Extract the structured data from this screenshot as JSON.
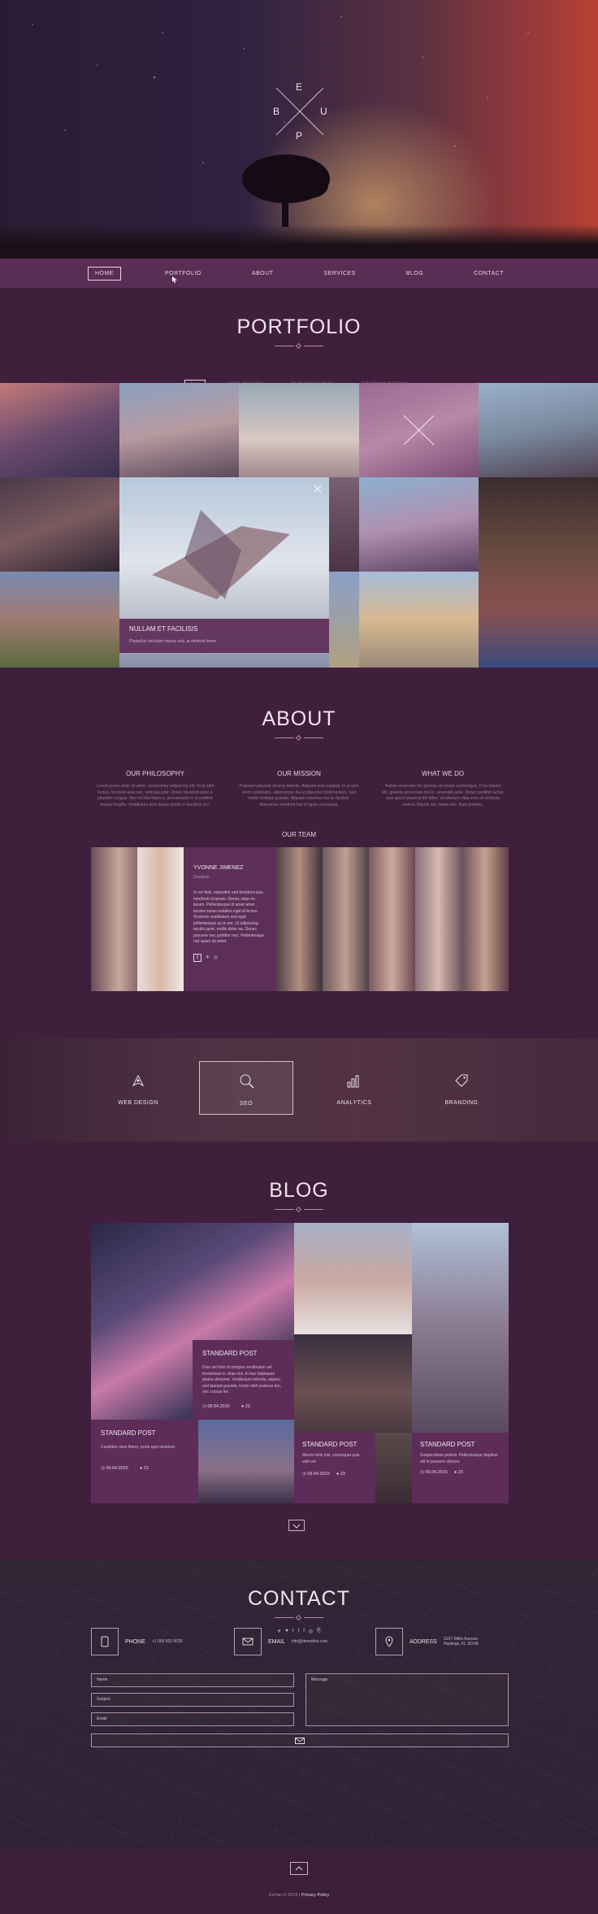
{
  "hero": {
    "logo_letters": [
      "E",
      "B",
      "U",
      "P"
    ]
  },
  "nav": {
    "items": [
      "HOME",
      "PORTFOLIO",
      "ABOUT",
      "SERVICES",
      "BLOG",
      "CONTACT"
    ],
    "active": "HOME"
  },
  "portfolio": {
    "title": "PORTFOLIO",
    "filters": [
      "ALL",
      "WEB DESIGN",
      "PHOTOGRAPHY",
      "GRAPHIC DESIGN"
    ],
    "active_filter": "ALL",
    "featured": {
      "title": "NULLAM ET FACILISIS",
      "subtitle": "Phasellus tincidunt mauris sed, at eleifend lorem"
    }
  },
  "about": {
    "title": "ABOUT",
    "columns": [
      {
        "heading": "OUR PHILOSOPHY",
        "text": "Lorem ipsum dolor sit amet, consectetur adipiscing elit. Ut at nibh luctus, tincidunt ante nec, vehicula ante. Donec tincidunt dolor a pharetra congue. Sed vel feis libero a, penuismodo in ut porttitor massa fringilla. Vestibulum ante ipsum primis in faucibus orci."
      },
      {
        "heading": "OUR MISSION",
        "text": "Praesent placerat sit eros lobortis. Aliquam erat volutpat. In ut sem enim sollicitudin, ullamcorper dui ut placerat condimentum. Sed mattis tristique gravida. Aliquam maximus dui ac facilisis. Maecenas hendrerit fuis in ligula consequat."
      },
      {
        "heading": "WHAT WE DO",
        "text": "Nullam venenatis leo gravida sit ornare scelerisque. Cras mauris elit, gravida accumsan nisi in, venenatis ante. Donec porttitor luctus quis ipsum placerat del lobor. Vestibulum vitae eros sit vehicula viverra. Mauris nec metus feis. Nam pretium."
      }
    ],
    "team_title": "OUR TEAM",
    "member": {
      "name": "YVONNE JIMENEZ",
      "role": "Designer",
      "bio": "In vel felis, imperdiet sed tincidunt quis, hendrerit id ipsum. Donec vitae mi ipsum. Pellentesque id amet amet lacinia varius sodales eget id lectus. Vivamus vestibulum sed eget pellentesque ac in est. Ut adipiscing iaculis jacet, mollis dolor aa. Donec posuere nec porttitor nec. Pellentesque nisl quam sit amet."
    }
  },
  "services": {
    "items": [
      "WEB DESIGN",
      "SEO",
      "ANALYTICS",
      "BRANDING"
    ],
    "active": "SEO"
  },
  "blog": {
    "title": "BLOG",
    "posts": [
      {
        "title": "STANDARD POST",
        "text": "Duis vel felis mi tempus vestibulum vel fermentum in vitae nisi. In hac habitasse platea dictumst. Vestibulum lobortis, sapien sed laoreet gravida, lorem nibh pulvinar leo, nec cursus leo.",
        "date": "09.04.2015",
        "comments": "23"
      },
      {
        "title": "STANDARD POST",
        "text": "Curabitur risus libero, porta quis tincidunt.",
        "date": "09.04.2015",
        "comments": "23"
      },
      {
        "title": "STANDARD POST",
        "text": "Mauris felis nisi, consequat quis velit vel.",
        "date": "09.04.2015",
        "comments": "23"
      },
      {
        "title": "STANDARD POST",
        "text": "Suspendisse potenti. Pellentesque dapibus elit in posuere ultrices.",
        "date": "09.04.2015",
        "comments": "23"
      }
    ]
  },
  "contact": {
    "title": "CONTACT",
    "social": [
      "✈",
      "♥",
      "𝔱",
      "t",
      "f",
      "◎",
      "⎘"
    ],
    "phone": {
      "label": "PHONE",
      "value": "+1 959 603 6035"
    },
    "email": {
      "label": "EMAIL",
      "value": "info@demolink.com"
    },
    "address": {
      "label": "ADDRESS",
      "value": "3167 Willis Avenue Hastings, FL 32145"
    },
    "fields": {
      "name": "Name",
      "subject": "Subject",
      "email": "Email",
      "message": "Message"
    }
  },
  "footer": {
    "copyright": "DeVan © 2015 |",
    "privacy": "Privacy Policy"
  },
  "colors": {
    "bg": "#401f3c",
    "nav": "#5a2d55",
    "accent_panel": "#5e2c59"
  }
}
